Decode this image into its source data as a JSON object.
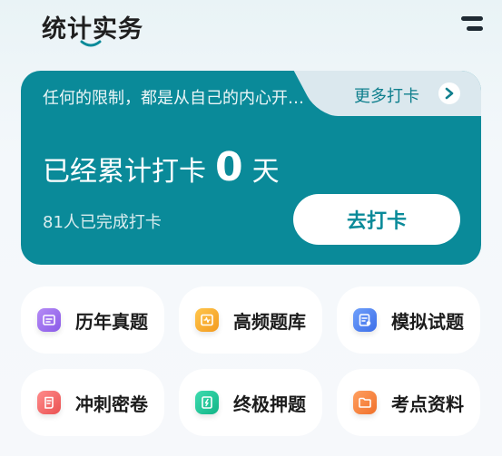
{
  "header": {
    "title": "统计实务"
  },
  "card": {
    "motto": "任何的限制，都是从自己的内心开…",
    "more_label": "更多打卡",
    "checkin_prefix": "已经累计打卡",
    "checkin_count": "0",
    "checkin_suffix": "天",
    "completed_text": "81人已完成打卡",
    "go_button": "去打卡"
  },
  "grid": {
    "items": [
      {
        "label": "历年真题",
        "icon": "calendar-doc-icon",
        "color": "#9a6bf0"
      },
      {
        "label": "高频题库",
        "icon": "waveform-doc-icon",
        "color": "#f7b12f"
      },
      {
        "label": "模拟试题",
        "icon": "exam-paper-icon",
        "color": "#4a80f0"
      },
      {
        "label": "冲刺密卷",
        "icon": "scroll-doc-icon",
        "color": "#f26a6a"
      },
      {
        "label": "终极押题",
        "icon": "lightning-doc-icon",
        "color": "#22c79a"
      },
      {
        "label": "考点资料",
        "icon": "folder-icon",
        "color": "#f7833a"
      }
    ]
  },
  "colors": {
    "accent": "#0a8a99",
    "page_bg": "#f4f8fb"
  }
}
